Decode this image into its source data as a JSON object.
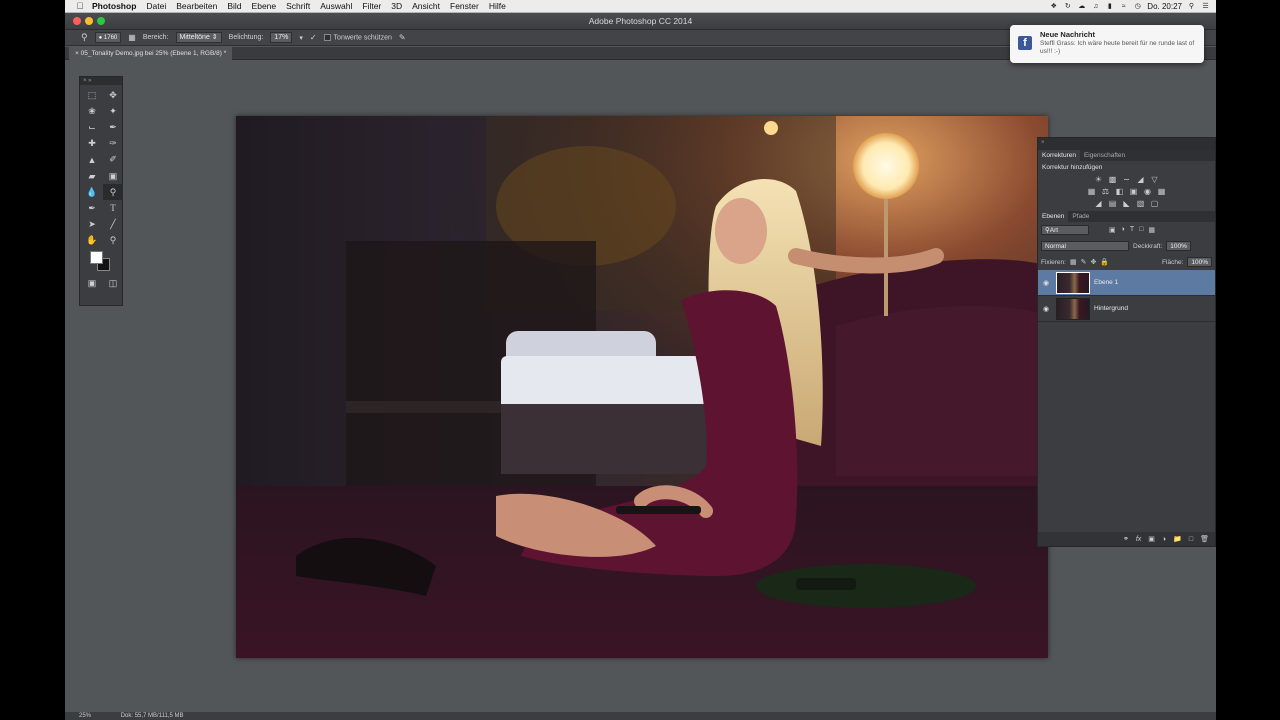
{
  "menubar": {
    "app": "Photoshop",
    "items": [
      "Datei",
      "Bearbeiten",
      "Bild",
      "Ebene",
      "Schrift",
      "Auswahl",
      "Filter",
      "3D",
      "Ansicht",
      "Fenster",
      "Hilfe"
    ],
    "clock": "Do. 20:27",
    "wifi_icon": "wifi-icon",
    "search_icon": "spotlight-icon"
  },
  "window": {
    "title": "Adobe Photoshop CC 2014"
  },
  "options": {
    "brush_size": "1760",
    "range_label": "Bereich:",
    "range_value": "Mitteltöne",
    "exposure_label": "Belichtung:",
    "exposure_value": "17%",
    "protect_tones": "Tonwerte schützen"
  },
  "document": {
    "tab_label": "05_Tonality Demo.jpg bei 25% (Ebene 1, RGB/8) *"
  },
  "notification": {
    "title": "Neue Nachricht",
    "message": "Steffi Grass: Ich wäre heute bereit für ne runde last of us!!! :-)"
  },
  "panels": {
    "tab_adjustments": "Korrekturen",
    "tab_properties": "Eigenschaften",
    "add_adjustment": "Korrektur hinzufügen",
    "tab_layers": "Ebenen",
    "tab_paths": "Pfade",
    "filter_kind": "Art",
    "blend_mode": "Normal",
    "opacity_label": "Deckkraft:",
    "opacity_value": "100%",
    "lock_label": "Fixieren:",
    "fill_label": "Fläche:",
    "fill_value": "100%",
    "layers": [
      {
        "name": "Ebene 1",
        "selected": true
      },
      {
        "name": "Hintergrund",
        "selected": false
      }
    ]
  },
  "statusbar": {
    "zoom": "25%",
    "doc_size": "Dok: 55,7 MB/111,5 MB"
  }
}
